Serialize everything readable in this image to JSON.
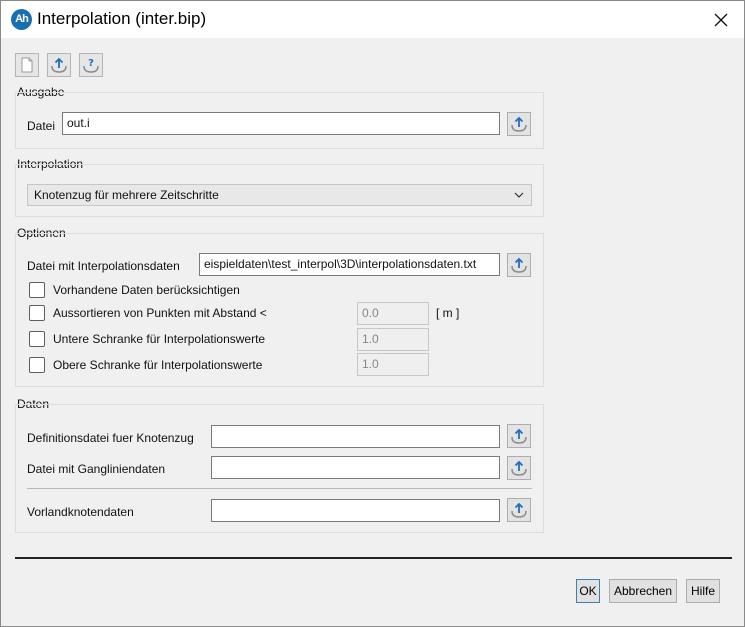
{
  "window": {
    "title": "Interpolation (inter.bip)",
    "app_icon_text": "Ah"
  },
  "toolbar": {
    "icons": [
      "new-document-icon",
      "upload-icon",
      "help-icon"
    ]
  },
  "ausgabe": {
    "label": "Ausgabe",
    "datei_label": "Datei",
    "datei_value": "out.i"
  },
  "interpolation": {
    "label": "Interpolation",
    "selected": "Knotenzug für mehrere Zeitschritte"
  },
  "optionen": {
    "label": "Optionen",
    "datei_label": "Datei mit Interpolationsdaten",
    "datei_value": "eispieldaten\\test_interpol\\3D\\interpolationsdaten.txt",
    "check_vorhandene": "Vorhandene Daten berücksichtigen",
    "check_aussortieren": "Aussortieren von Punkten mit Abstand <",
    "abstand_value": "0.0",
    "abstand_unit": "[ m ]",
    "check_untere": "Untere Schranke für Interpolationswerte",
    "untere_value": "1.0",
    "check_obere": "Obere Schranke für Interpolationswerte",
    "obere_value": "1.0"
  },
  "daten": {
    "label": "Daten",
    "def_label": "Definitionsdatei fuer Knotenzug",
    "def_value": "",
    "gang_label": "Datei mit Gangliniendaten",
    "gang_value": "",
    "vorland_label": "Vorlandknotendaten",
    "vorland_value": ""
  },
  "buttons": {
    "ok": "OK",
    "cancel": "Abbrechen",
    "help": "Hilfe"
  },
  "colors": {
    "app_icon": "#1a6fb0",
    "titlebar": "#ffffff",
    "background": "#f0f0f0"
  }
}
